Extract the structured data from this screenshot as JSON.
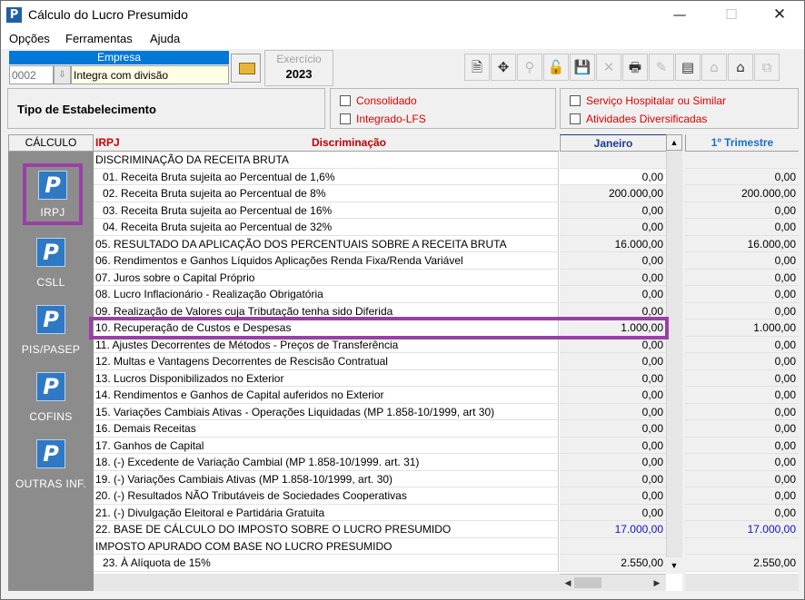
{
  "window": {
    "title": "Cálculo do Lucro Presumido",
    "app_icon": "P",
    "minimize": "—",
    "maximize": "☐",
    "close": "✕"
  },
  "menu": [
    {
      "label": "Opções"
    },
    {
      "label": "Ferramentas"
    },
    {
      "label": "Ajuda"
    }
  ],
  "empresa": {
    "label": "Empresa",
    "code": "0002",
    "name": "Integra com divisão"
  },
  "exercicio": {
    "label": "Exercício",
    "value": "2023"
  },
  "toolbar_icons": [
    {
      "name": "document-icon",
      "glyph": "🗎",
      "enabled": true
    },
    {
      "name": "navigate-icon",
      "glyph": "✥",
      "enabled": true
    },
    {
      "name": "search-icon",
      "glyph": "⚲",
      "enabled": false
    },
    {
      "name": "unlock-icon",
      "glyph": "🔓",
      "enabled": true
    },
    {
      "name": "save-icon",
      "glyph": "💾",
      "enabled": true
    },
    {
      "name": "delete-icon",
      "glyph": "✕",
      "enabled": false
    },
    {
      "name": "print-icon",
      "glyph": "🖶",
      "enabled": true
    },
    {
      "name": "sign-icon",
      "glyph": "✎",
      "enabled": false
    },
    {
      "name": "report-icon",
      "glyph": "▤",
      "enabled": true
    },
    {
      "name": "export-icon",
      "glyph": "⌂",
      "enabled": false
    },
    {
      "name": "import-icon",
      "glyph": "⌂",
      "enabled": true
    },
    {
      "name": "copy-icon",
      "glyph": "⧉",
      "enabled": false
    }
  ],
  "tipo_estabelecimento": {
    "title": "Tipo de Estabelecimento",
    "options_left": [
      "Consolidado",
      "Integrado-LFS"
    ],
    "options_right": [
      "Serviço Hospitalar ou Similar",
      "Atividades Diversificadas"
    ]
  },
  "calculo": {
    "header": "CÁLCULO",
    "items": [
      {
        "label": "IRPJ",
        "selected": true
      },
      {
        "label": "CSLL",
        "selected": false
      },
      {
        "label": "PIS/PASEP",
        "selected": false
      },
      {
        "label": "COFINS",
        "selected": false
      },
      {
        "label": "OUTRAS INF.",
        "selected": false
      }
    ]
  },
  "grid": {
    "headers": {
      "irpj": "IRPJ",
      "discriminacao": "Discriminação",
      "janeiro": "Janeiro",
      "trimestre": "1º Trimestre"
    },
    "rows": [
      {
        "desc": "DISCRIMINAÇÃO DA RECEITA BRUTA",
        "jan": "",
        "tri": "",
        "sub": false
      },
      {
        "desc": "01. Receita Bruta sujeita ao Percentual de 1,6%",
        "jan": "0,00",
        "tri": "0,00",
        "sub": true
      },
      {
        "desc": "02. Receita Bruta sujeita ao Percentual de 8%",
        "jan": "200.000,00",
        "tri": "200.000,00",
        "sub": true
      },
      {
        "desc": "03. Receita Bruta sujeita ao Percentual de 16%",
        "jan": "0,00",
        "tri": "0,00",
        "sub": true
      },
      {
        "desc": "04. Receita Bruta sujeita ao Percentual de 32%",
        "jan": "0,00",
        "tri": "0,00",
        "sub": true
      },
      {
        "desc": "05. RESULTADO DA APLICAÇÃO DOS PERCENTUAIS SOBRE A RECEITA BRUTA",
        "jan": "16.000,00",
        "tri": "16.000,00",
        "sub": false
      },
      {
        "desc": "06. Rendimentos e Ganhos Líquidos Aplicações Renda Fixa/Renda Variável",
        "jan": "0,00",
        "tri": "0,00",
        "sub": false
      },
      {
        "desc": "07. Juros sobre o Capital Próprio",
        "jan": "0,00",
        "tri": "0,00",
        "sub": false
      },
      {
        "desc": "08. Lucro Inflacionário - Realização Obrigatória",
        "jan": "0,00",
        "tri": "0,00",
        "sub": false
      },
      {
        "desc": "09. Realização de Valores cuja Tributação tenha sido Diferida",
        "jan": "0,00",
        "tri": "0,00",
        "sub": false
      },
      {
        "desc": "10. Recuperação de Custos e Despesas",
        "jan": "1.000,00",
        "tri": "1.000,00",
        "sub": false
      },
      {
        "desc": "11. Ajustes Decorrentes de Métodos - Preços de Transferência",
        "jan": "0,00",
        "tri": "0,00",
        "sub": false
      },
      {
        "desc": "12. Multas e Vantagens Decorrentes de Rescisão Contratual",
        "jan": "0,00",
        "tri": "0,00",
        "sub": false
      },
      {
        "desc": "13. Lucros Disponibilizados no Exterior",
        "jan": "0,00",
        "tri": "0,00",
        "sub": false
      },
      {
        "desc": "14. Rendimentos e Ganhos de Capital auferidos no Exterior",
        "jan": "0,00",
        "tri": "0,00",
        "sub": false
      },
      {
        "desc": "15. Variações Cambiais Ativas - Operações Liquidadas (MP 1.858-10/1999, art 30)",
        "jan": "0,00",
        "tri": "0,00",
        "sub": false
      },
      {
        "desc": "16. Demais Receitas",
        "jan": "0,00",
        "tri": "0,00",
        "sub": false
      },
      {
        "desc": "17. Ganhos de Capital",
        "jan": "0,00",
        "tri": "0,00",
        "sub": false
      },
      {
        "desc": "18. (-) Excedente de Variação Cambial (MP 1.858-10/1999. art. 31)",
        "jan": "0,00",
        "tri": "0,00",
        "sub": false
      },
      {
        "desc": "19. (-) Variações Cambiais Ativas (MP 1.858-10/1999, art. 30)",
        "jan": "0,00",
        "tri": "0,00",
        "sub": false
      },
      {
        "desc": "20. (-) Resultados NÃO Tributáveis de Sociedades Cooperativas",
        "jan": "0,00",
        "tri": "0,00",
        "sub": false
      },
      {
        "desc": "21. (-) Divulgação Eleitoral e Partidária Gratuita",
        "jan": "0,00",
        "tri": "0,00",
        "sub": false
      },
      {
        "desc": "22. BASE DE CÁLCULO DO IMPOSTO SOBRE O LUCRO PRESUMIDO",
        "jan": "17.000,00",
        "tri": "17.000,00",
        "sub": false,
        "blue": true
      },
      {
        "desc": "IMPOSTO APURADO COM BASE NO LUCRO PRESUMIDO",
        "jan": "",
        "tri": "",
        "sub": false
      },
      {
        "desc": "23. À Alíquota de 15%",
        "jan": "2.550,00",
        "tri": "2.550,00",
        "sub": true
      }
    ],
    "highlighted_row": 10
  },
  "colors": {
    "accent": "#0078d7",
    "highlight_border": "#9b3fa8",
    "red_label": "#e00000",
    "blue_value": "#1010d0"
  }
}
